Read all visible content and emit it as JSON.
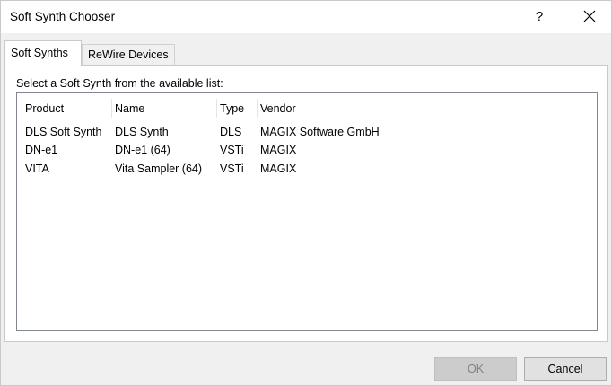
{
  "window": {
    "title": "Soft Synth Chooser",
    "help_label": "?"
  },
  "tabs": [
    {
      "label": "Soft Synths",
      "active": true
    },
    {
      "label": "ReWire Devices",
      "active": false
    }
  ],
  "panel": {
    "instruction": "Select a Soft Synth from the available list:"
  },
  "table": {
    "columns": [
      "Product",
      "Name",
      "Type",
      "Vendor"
    ],
    "rows": [
      {
        "product": "DLS Soft Synth",
        "name": "DLS Synth",
        "type": "DLS",
        "vendor": "MAGIX Software GmbH"
      },
      {
        "product": "DN-e1",
        "name": "DN-e1 (64)",
        "type": "VSTi",
        "vendor": "MAGIX"
      },
      {
        "product": "VITA",
        "name": "Vita Sampler (64)",
        "type": "VSTi",
        "vendor": "MAGIX"
      }
    ]
  },
  "buttons": {
    "ok_label": "OK",
    "cancel_label": "Cancel"
  },
  "colors": {
    "window_bg": "#f0f0f0",
    "panel_bg": "#ffffff",
    "disabled_text": "#838383"
  },
  "icons": {
    "close": "close-icon"
  }
}
